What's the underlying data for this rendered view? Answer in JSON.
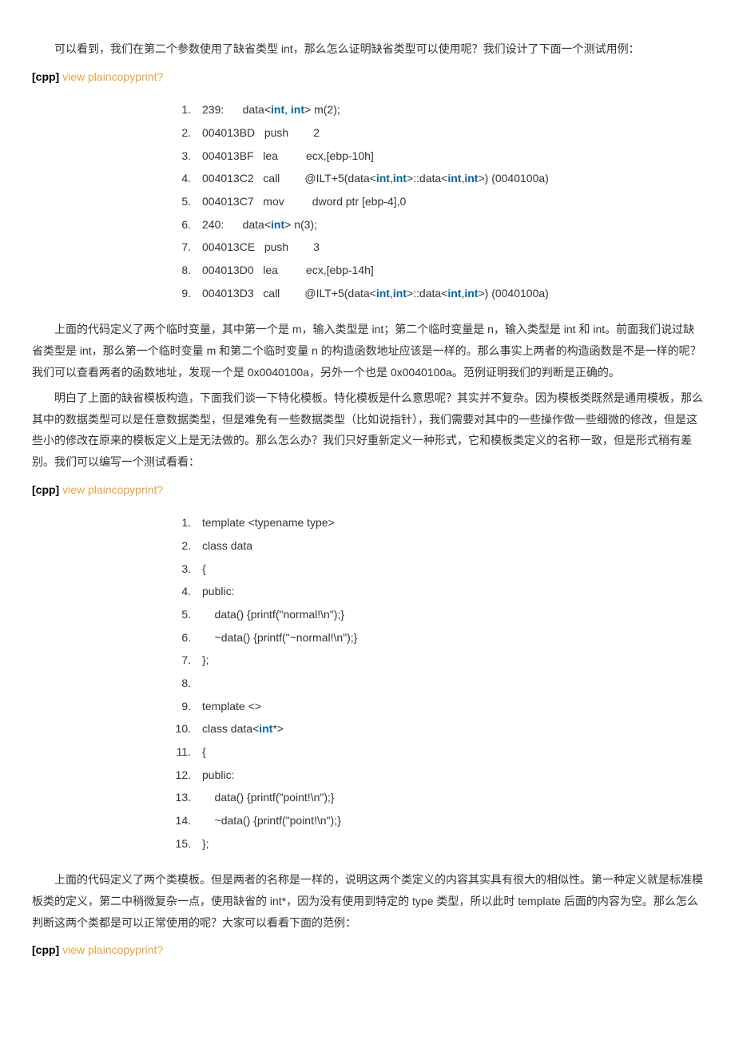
{
  "paras": {
    "p1": "可以看到，我们在第二个参数使用了缺省类型 int，那么怎么证明缺省类型可以使用呢？我们设计了下面一个测试用例：",
    "p2": "上面的代码定义了两个临时变量，其中第一个是 m，输入类型是 int；第二个临时变量是 n，输入类型是 int 和 int。前面我们说过缺省类型是 int，那么第一个临时变量 m 和第二个临时变量 n 的构造函数地址应该是一样的。那么事实上两者的构造函数是不是一样的呢？我们可以查看两者的函数地址，发现一个是 0x0040100a，另外一个也是 0x0040100a。范例证明我们的判断是正确的。",
    "p3": "明白了上面的缺省模板构造，下面我们谈一下特化模板。特化模板是什么意思呢？其实并不复杂。因为模板类既然是通用模板，那么其中的数据类型可以是任意数据类型，但是难免有一些数据类型（比如说指针），我们需要对其中的一些操作做一些细微的修改，但是这些小的修改在原来的模板定义上是无法做的。那么怎么办？我们只好重新定义一种形式，它和模板类定义的名称一致，但是形式稍有差别。我们可以编写一个测试看看：",
    "p4": "上面的代码定义了两个类模板。但是两者的名称是一样的，说明这两个类定义的内容其实具有很大的相似性。第一种定义就是标准模板类的定义，第二中稍微复杂一点，使用缺省的 int*，因为没有使用到特定的 type 类型，所以此时 template 后面的内容为空。那么怎么判断这两个类都是可以正常使用的呢？大家可以看看下面的范例："
  },
  "labels": {
    "cpp": "[cpp]",
    "view": "view plain",
    "copy": "copy",
    "print": "print",
    "q": "?"
  },
  "code1": [
    {
      "n": "1.",
      "pre": "239:      data<",
      "k1": "int",
      "mid": ", ",
      "k2": "int",
      "post": "> m(2);  "
    },
    {
      "n": "2.",
      "pre": "004013BD   push        2  ",
      "k1": "",
      "mid": "",
      "k2": "",
      "post": ""
    },
    {
      "n": "3.",
      "pre": "004013BF   lea         ecx,[ebp-10h]  ",
      "k1": "",
      "mid": "",
      "k2": "",
      "post": ""
    },
    {
      "n": "4.",
      "pre": "004013C2   call        @ILT+5(data<",
      "k1": "int",
      "mid": ",",
      "k2": "int",
      "post": ""
    },
    {
      "n": "5.",
      "pre": "004013C7   mov         dword ptr [ebp-4],0  ",
      "k1": "",
      "mid": "",
      "k2": "",
      "post": ""
    },
    {
      "n": "6.",
      "pre": "240:      data<",
      "k1": "int",
      "mid": "",
      "k2": "",
      "post": "> n(3);  "
    },
    {
      "n": "7.",
      "pre": "004013CE   push        3  ",
      "k1": "",
      "mid": "",
      "k2": "",
      "post": ""
    },
    {
      "n": "8.",
      "pre": "004013D0   lea         ecx,[ebp-14h]  ",
      "k1": "",
      "mid": "",
      "k2": "",
      "post": ""
    },
    {
      "n": "9.",
      "pre": "004013D3   call        @ILT+5(data<",
      "k1": "int",
      "mid": ",",
      "k2": "int",
      "post": ""
    }
  ],
  "code1_tail": {
    "a": ">::data<",
    "b": ">) (0040100a)  "
  },
  "code2": [
    {
      "n": "1.",
      "t": "template <typename type>  "
    },
    {
      "n": "2.",
      "t": "class data  "
    },
    {
      "n": "3.",
      "t": "{  "
    },
    {
      "n": "4.",
      "t": "public:  "
    },
    {
      "n": "5.",
      "t": "    data() {printf(\"normal!\\n\");}  "
    },
    {
      "n": "6.",
      "t": "    ~data() {printf(\"~normal!\\n\");}  "
    },
    {
      "n": "7.",
      "t": "};  "
    },
    {
      "n": "8.",
      "t": "  "
    },
    {
      "n": "9.",
      "t": "template <>  "
    },
    {
      "n": "10.",
      "t": "class data<",
      "k": "int",
      "t2": "*>  "
    },
    {
      "n": "11.",
      "t": "{  "
    },
    {
      "n": "12.",
      "t": "public:  "
    },
    {
      "n": "13.",
      "t": "    data() {printf(\"point!\\n\");}  "
    },
    {
      "n": "14.",
      "t": "    ~data() {printf(\"point!\\n\");}  "
    },
    {
      "n": "15.",
      "t": "};  "
    }
  ]
}
